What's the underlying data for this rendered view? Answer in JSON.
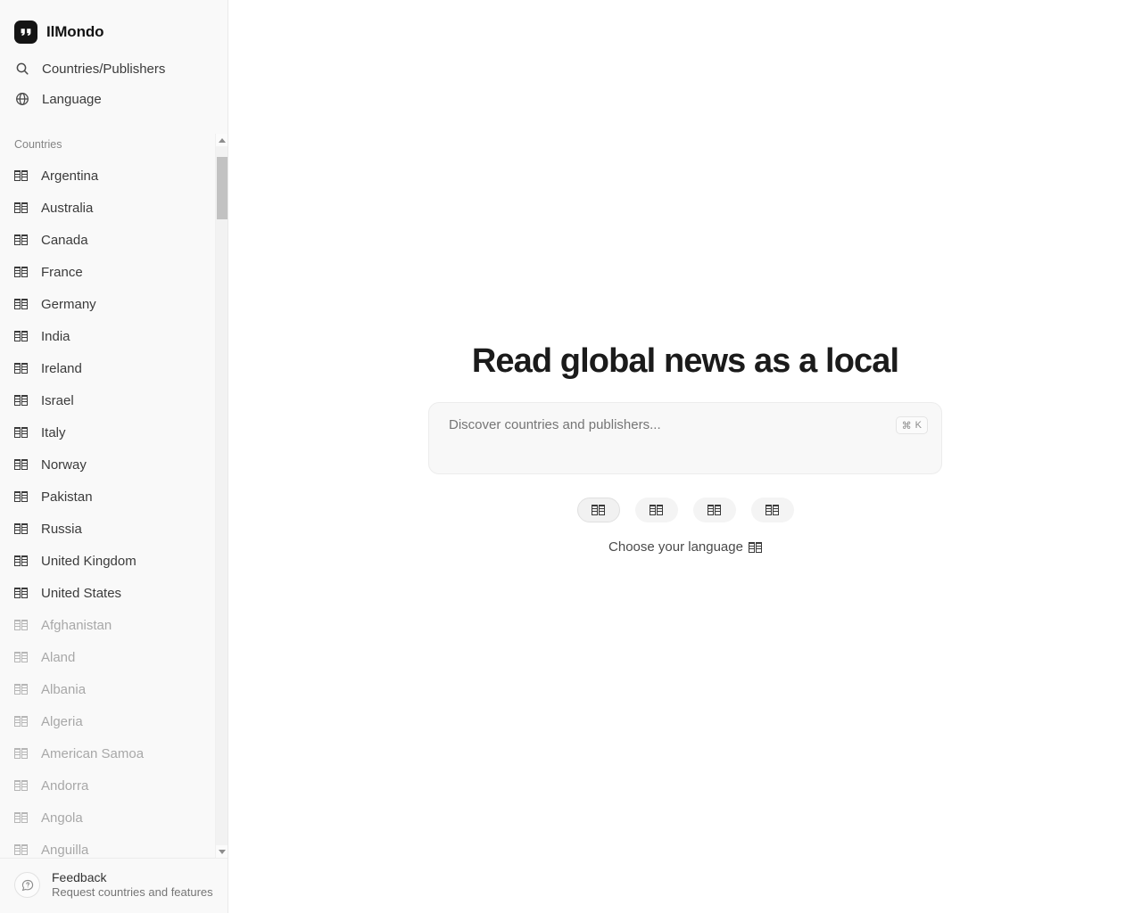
{
  "brand": {
    "name": "IlMondo",
    "logo_icon": "quote-mark-logo-icon",
    "logo_color": "#141414"
  },
  "sidebar": {
    "nav": [
      {
        "label": "Countries/Publishers",
        "icon": "search-icon"
      },
      {
        "label": "Language",
        "icon": "globe-icon"
      }
    ],
    "section_label": "Countries",
    "featured_countries": [
      "Argentina",
      "Australia",
      "Canada",
      "France",
      "Germany",
      "India",
      "Ireland",
      "Israel",
      "Italy",
      "Norway",
      "Pakistan",
      "Russia",
      "United Kingdom",
      "United States"
    ],
    "more_countries": [
      "Afghanistan",
      "Aland",
      "Albania",
      "Algeria",
      "American Samoa",
      "Andorra",
      "Angola",
      "Anguilla"
    ],
    "feedback": {
      "title": "Feedback",
      "subtitle": "Request countries and features",
      "icon": "question-speech-bubble-icon"
    },
    "scrollbar": {
      "up_arrow_icon": "triangle-up-icon",
      "down_arrow_icon": "triangle-down-icon"
    }
  },
  "main": {
    "title": "Read global news as a local",
    "search": {
      "placeholder": "Discover countries and publishers...",
      "shortcut_modifier": "⌘",
      "shortcut_key": "K"
    },
    "language_pills": [
      {
        "flag_icon": "flag-tofu-icon",
        "selected": true
      },
      {
        "flag_icon": "flag-tofu-icon",
        "selected": false
      },
      {
        "flag_icon": "flag-tofu-icon",
        "selected": false
      },
      {
        "flag_icon": "flag-tofu-icon",
        "selected": false
      }
    ],
    "language_caption": "Choose your language"
  },
  "colors": {
    "sidebar_bg": "#f9f9f9",
    "main_bg": "#ffffff",
    "text_primary": "#1b1b1b",
    "text_secondary": "#3b3b3b",
    "text_muted": "#a8a8a8",
    "search_bg": "#f8f8f8"
  }
}
